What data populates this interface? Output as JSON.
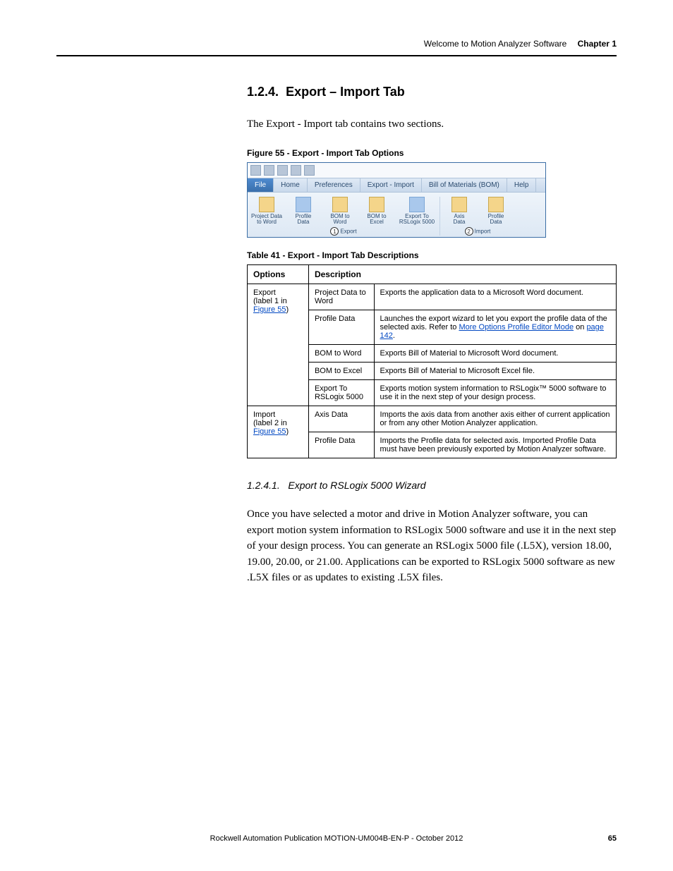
{
  "header": {
    "light": "Welcome to Motion Analyzer Software",
    "bold": "Chapter 1"
  },
  "section": {
    "number": "1.2.4.",
    "title": "Export – Import Tab",
    "intro": "The Export - Import tab contains two sections."
  },
  "figure55": {
    "caption": "Figure 55 - Export - Import Tab Options",
    "tabs": [
      "File",
      "Home",
      "Preferences",
      "Export - Import",
      "Bill of Materials (BOM)",
      "Help"
    ],
    "export_group": {
      "name": "Export",
      "buttons": [
        {
          "label": "Project Data\nto Word"
        },
        {
          "label": "Profile\nData"
        },
        {
          "label": "BOM to\nWord"
        },
        {
          "label": "BOM to\nExcel"
        },
        {
          "label": "Export To\nRSLogix 5000"
        }
      ],
      "callout": "1"
    },
    "import_group": {
      "name": "Import",
      "buttons": [
        {
          "label": "Axis\nData"
        },
        {
          "label": "Profile\nData"
        }
      ],
      "callout": "2"
    }
  },
  "table41": {
    "caption": "Table 41 - Export - Import Tab Descriptions",
    "headers": {
      "c1": "Options",
      "c2": "Description"
    },
    "export_label": "Export",
    "export_sub_prefix": "(label 1 in ",
    "export_sub_link": "Figure 55",
    "export_sub_suffix": ")",
    "import_label": "Import",
    "import_sub_prefix": "(label 2 in ",
    "import_sub_link": "Figure 55",
    "import_sub_suffix": ")",
    "rows": {
      "e1": {
        "opt": "Project Data to Word",
        "desc": "Exports the application data to a Microsoft Word document."
      },
      "e2": {
        "opt": "Profile Data",
        "desc_pre": "Launches the export wizard to let you export the profile data of the selected axis. Refer to ",
        "link": "More Options Profile Editor Mode",
        "desc_mid": " on ",
        "link2": "page 142",
        "desc_post": "."
      },
      "e3": {
        "opt": "BOM to Word",
        "desc": "Exports Bill of Material to Microsoft Word document."
      },
      "e4": {
        "opt": "BOM to Excel",
        "desc": "Exports Bill of Material to Microsoft Excel file."
      },
      "e5": {
        "opt": "Export To RSLogix 5000",
        "desc": "Exports motion system information to RSLogix™ 5000 software to use it in the next step of your design process."
      },
      "i1": {
        "opt": "Axis Data",
        "desc": "Imports the axis data from another axis either of current application or from any other Motion Analyzer application."
      },
      "i2": {
        "opt": "Profile Data",
        "desc": "Imports the Profile data for selected axis. Imported Profile Data must have been previously exported by Motion Analyzer software."
      }
    }
  },
  "subsection": {
    "number": "1.2.4.1.",
    "title": "Export to RSLogix 5000 Wizard",
    "body": "Once you have selected a motor and drive in Motion Analyzer software, you can export motion system information to RSLogix 5000 software and use it in the next step of your design process. You can generate an RSLogix 5000 file (.L5X), version 18.00, 19.00, 20.00, or 21.00. Applications can be exported to RSLogix 5000 software as new .L5X files or as updates to existing .L5X files."
  },
  "footer": {
    "text": "Rockwell Automation Publication MOTION-UM004B-EN-P - October 2012",
    "page": "65"
  }
}
